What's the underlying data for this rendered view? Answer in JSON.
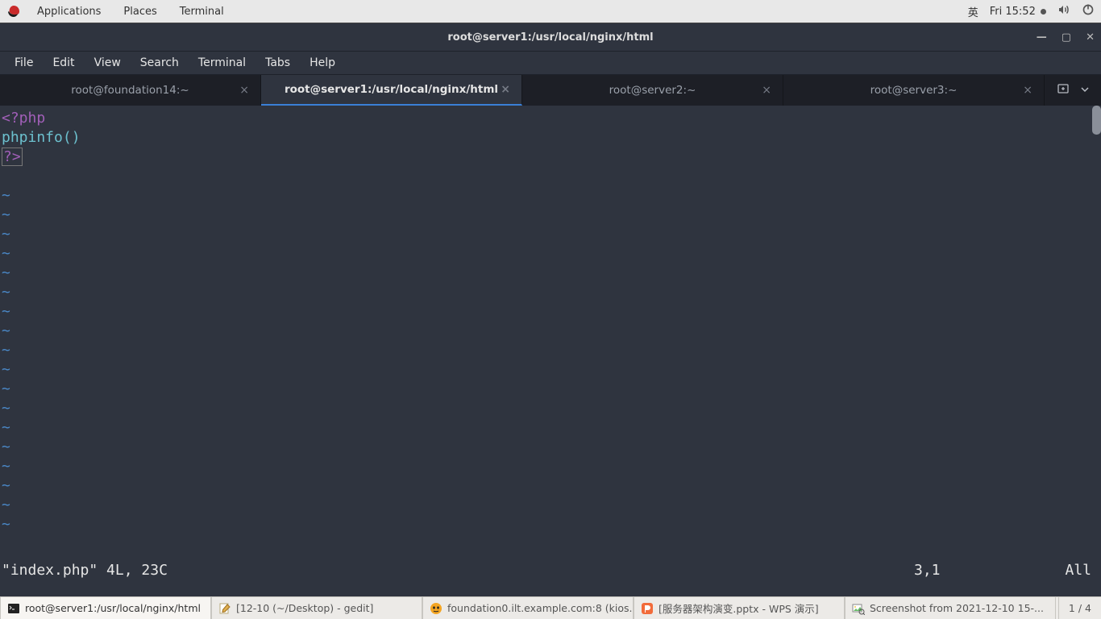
{
  "panel": {
    "menus": [
      "Applications",
      "Places",
      "Terminal"
    ],
    "ime": "英",
    "clock": "Fri 15:52"
  },
  "window": {
    "title": "root@server1:/usr/local/nginx/html"
  },
  "menubar": [
    "File",
    "Edit",
    "View",
    "Search",
    "Terminal",
    "Tabs",
    "Help"
  ],
  "tabs": [
    {
      "label": "root@foundation14:~",
      "active": false
    },
    {
      "label": "root@server1:/usr/local/nginx/html",
      "active": true
    },
    {
      "label": "root@server2:~",
      "active": false
    },
    {
      "label": "root@server3:~",
      "active": false
    }
  ],
  "editor": {
    "line1_open": "<?php",
    "line2_indent": "    ",
    "line2_func": "phpinfo",
    "line2_paren": "()",
    "line3_close": "?>",
    "status_file": "\"index.php\" 4L, 23C",
    "status_pos": "3,1",
    "status_pct": "All"
  },
  "taskbar": {
    "tasks": [
      "root@server1:/usr/local/nginx/html",
      "[12-10 (~/Desktop) - gedit]",
      "foundation0.ilt.example.com:8 (kios...",
      "[服务器架构演变.pptx - WPS 演示]",
      "Screenshot from 2021-12-10 15-..."
    ],
    "workspace": "1 / 4"
  }
}
